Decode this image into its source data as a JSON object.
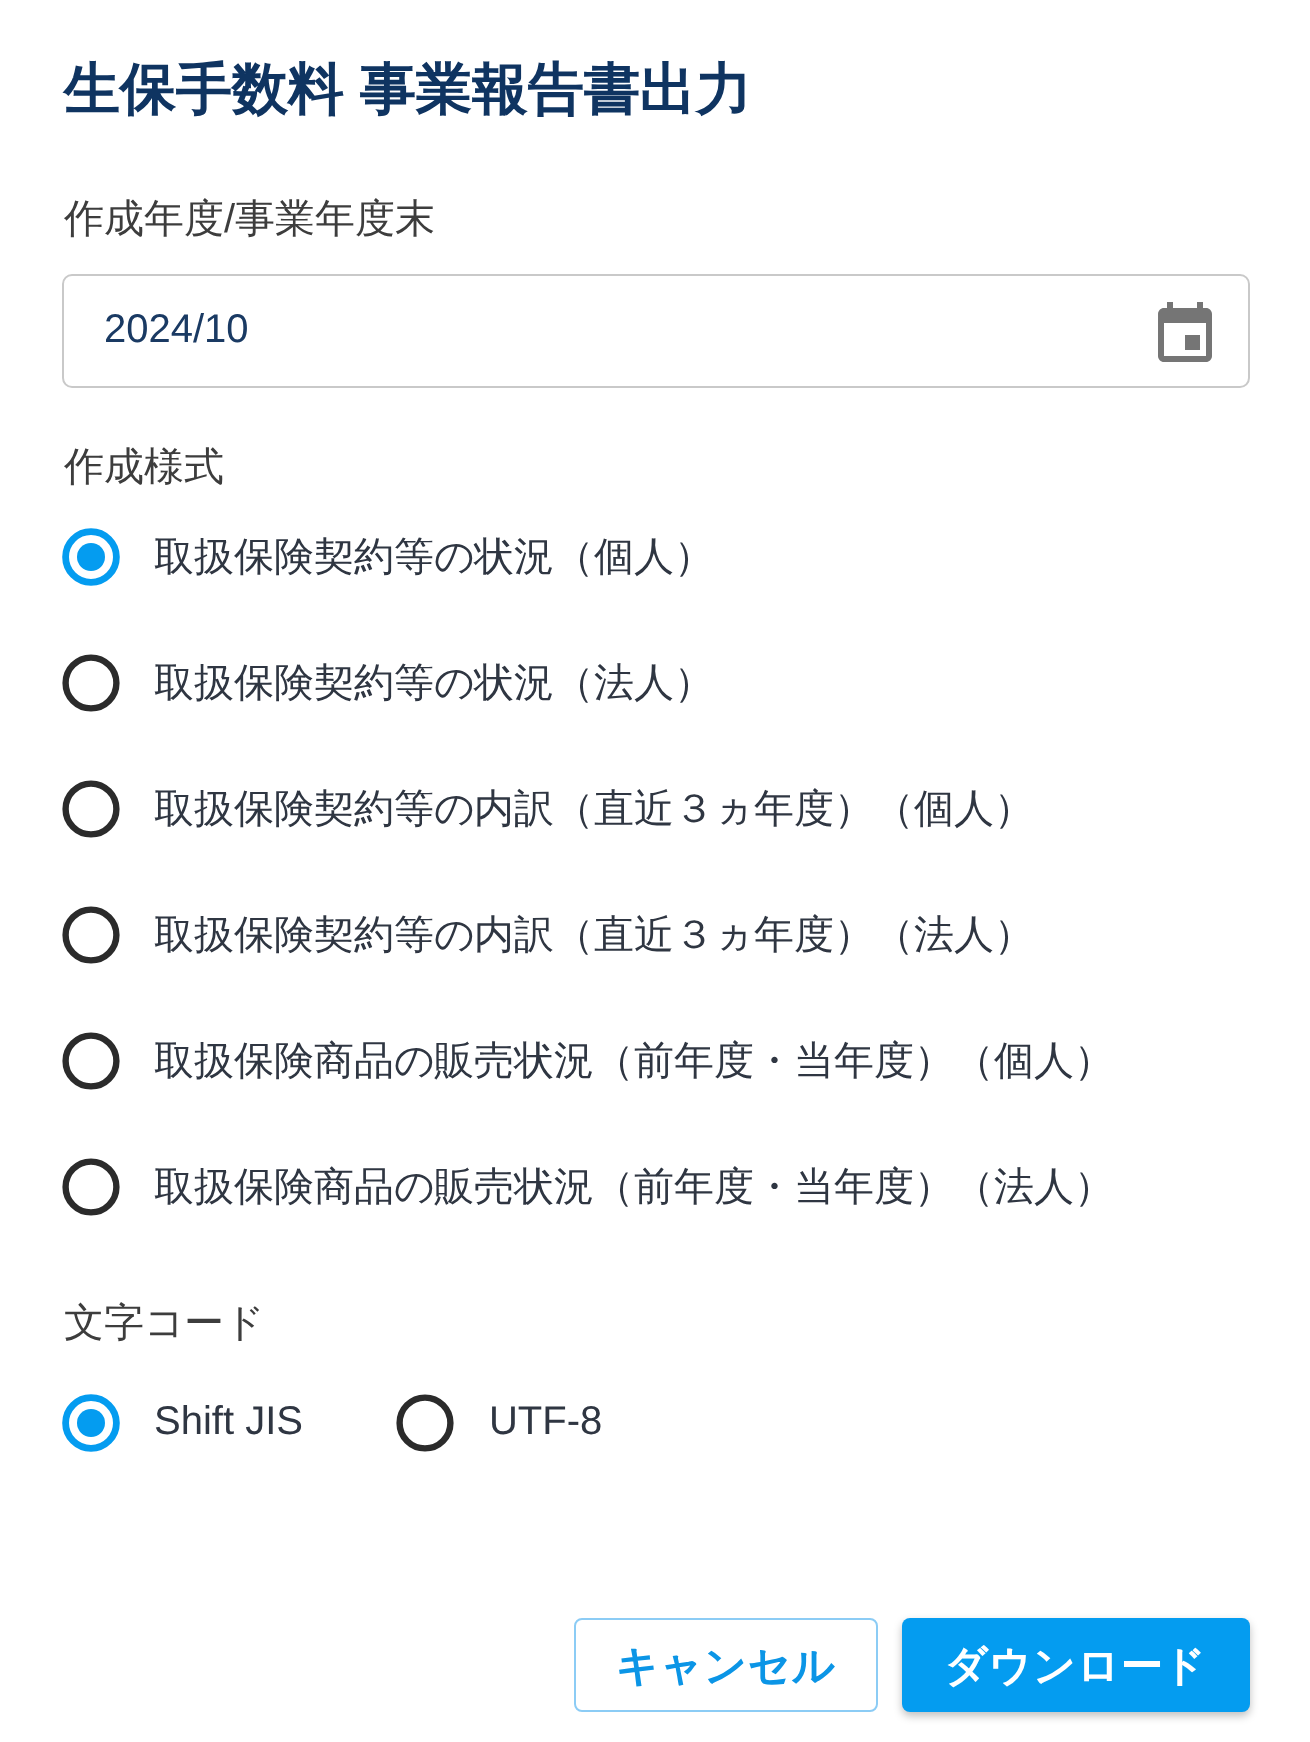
{
  "dialog": {
    "title": "生保手数料 事業報告書出力"
  },
  "period": {
    "label": "作成年度/事業年度末",
    "value": "2024/10"
  },
  "format": {
    "label": "作成様式",
    "options": [
      {
        "label": "取扱保険契約等の状況（個人）",
        "selected": true
      },
      {
        "label": "取扱保険契約等の状況（法人）",
        "selected": false
      },
      {
        "label": "取扱保険契約等の内訳（直近３ヵ年度）（個人）",
        "selected": false
      },
      {
        "label": "取扱保険契約等の内訳（直近３ヵ年度）（法人）",
        "selected": false
      },
      {
        "label": "取扱保険商品の販売状況（前年度・当年度）（個人）",
        "selected": false
      },
      {
        "label": "取扱保険商品の販売状況（前年度・当年度）（法人）",
        "selected": false
      }
    ]
  },
  "encoding": {
    "label": "文字コード",
    "options": [
      {
        "label": "Shift JIS",
        "selected": true
      },
      {
        "label": "UTF-8",
        "selected": false
      }
    ]
  },
  "buttons": [
    {
      "label": "キャンセル",
      "kind": "outlined"
    },
    {
      "label": "ダウンロード",
      "kind": "contained"
    }
  ]
}
